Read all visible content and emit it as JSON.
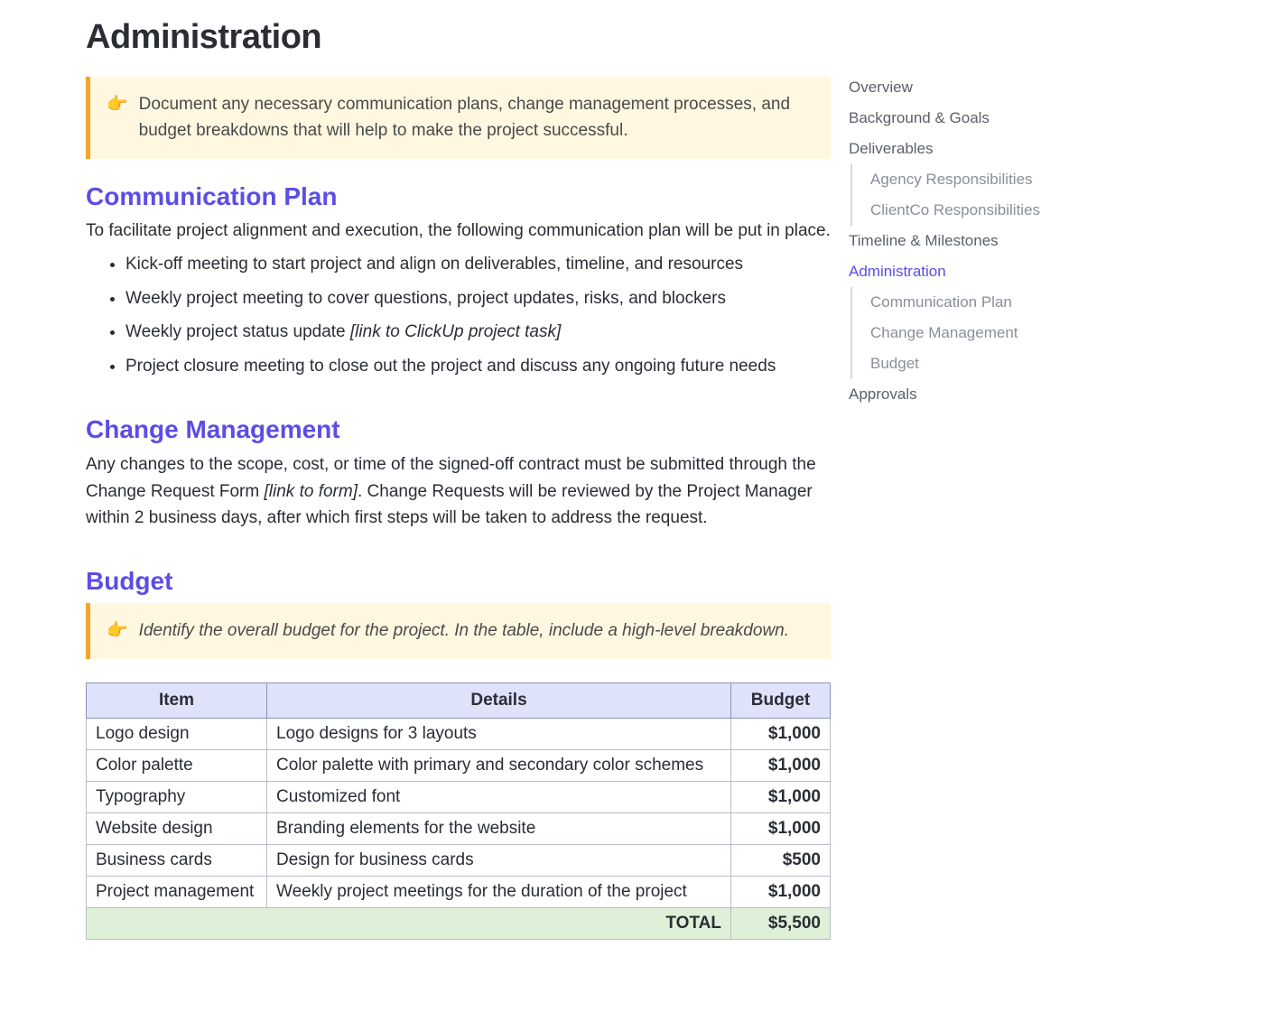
{
  "title": "Administration",
  "callout1": "Document any necessary communication plans, change management processes, and budget breakdowns that will help to make the project successful.",
  "comm": {
    "heading": "Communication Plan",
    "intro": "To facilitate project alignment and execution, the following communication plan will be put in place.",
    "items": [
      {
        "text": "Kick-off meeting to start project and align on deliverables, timeline, and resources"
      },
      {
        "text": "Weekly project meeting to cover questions, project updates, risks, and blockers"
      },
      {
        "text": "Weekly project status update ",
        "ital": "[link to ClickUp project task]"
      },
      {
        "text": "Project closure meeting to close out the project and discuss any ongoing future needs"
      }
    ]
  },
  "change": {
    "heading": "Change Management",
    "para_pre": "Any changes to the scope, cost, or time of the signed-off contract must be submitted through the Change Request Form ",
    "para_ital": "[link to form]",
    "para_post": ". Change Requests will be reviewed by the Project Manager within 2 business days, after which first steps will be taken to address the request."
  },
  "budget": {
    "heading": "Budget",
    "callout": "Identify the overall budget for the project. In the table, include a high-level breakdown.",
    "headers": {
      "item": "Item",
      "details": "Details",
      "budget": "Budget"
    },
    "rows": [
      {
        "item": "Logo design",
        "details": "Logo designs for 3 layouts",
        "budget": "$1,000"
      },
      {
        "item": "Color palette",
        "details": "Color palette with primary and secondary color schemes",
        "budget": "$1,000"
      },
      {
        "item": "Typography",
        "details": "Customized font",
        "budget": "$1,000"
      },
      {
        "item": "Website design",
        "details": "Branding elements for the website",
        "budget": "$1,000"
      },
      {
        "item": "Business cards",
        "details": "Design for business cards",
        "budget": "$500"
      },
      {
        "item": "Project management",
        "details": "Weekly project meetings for the duration of the project",
        "budget": "$1,000"
      }
    ],
    "total_label": "TOTAL",
    "total_value": "$5,500"
  },
  "toc": [
    {
      "label": "Overview",
      "level": 1
    },
    {
      "label": "Background & Goals",
      "level": 1
    },
    {
      "label": "Deliverables",
      "level": 1
    },
    {
      "label": "Agency Responsibilities",
      "level": 2
    },
    {
      "label": "ClientCo Responsibilities",
      "level": 2
    },
    {
      "label": "Timeline & Milestones",
      "level": 1
    },
    {
      "label": "Administration",
      "level": 1,
      "active": true
    },
    {
      "label": "Communication Plan",
      "level": 2
    },
    {
      "label": "Change Management",
      "level": 2
    },
    {
      "label": "Budget",
      "level": 2
    },
    {
      "label": "Approvals",
      "level": 1
    }
  ]
}
